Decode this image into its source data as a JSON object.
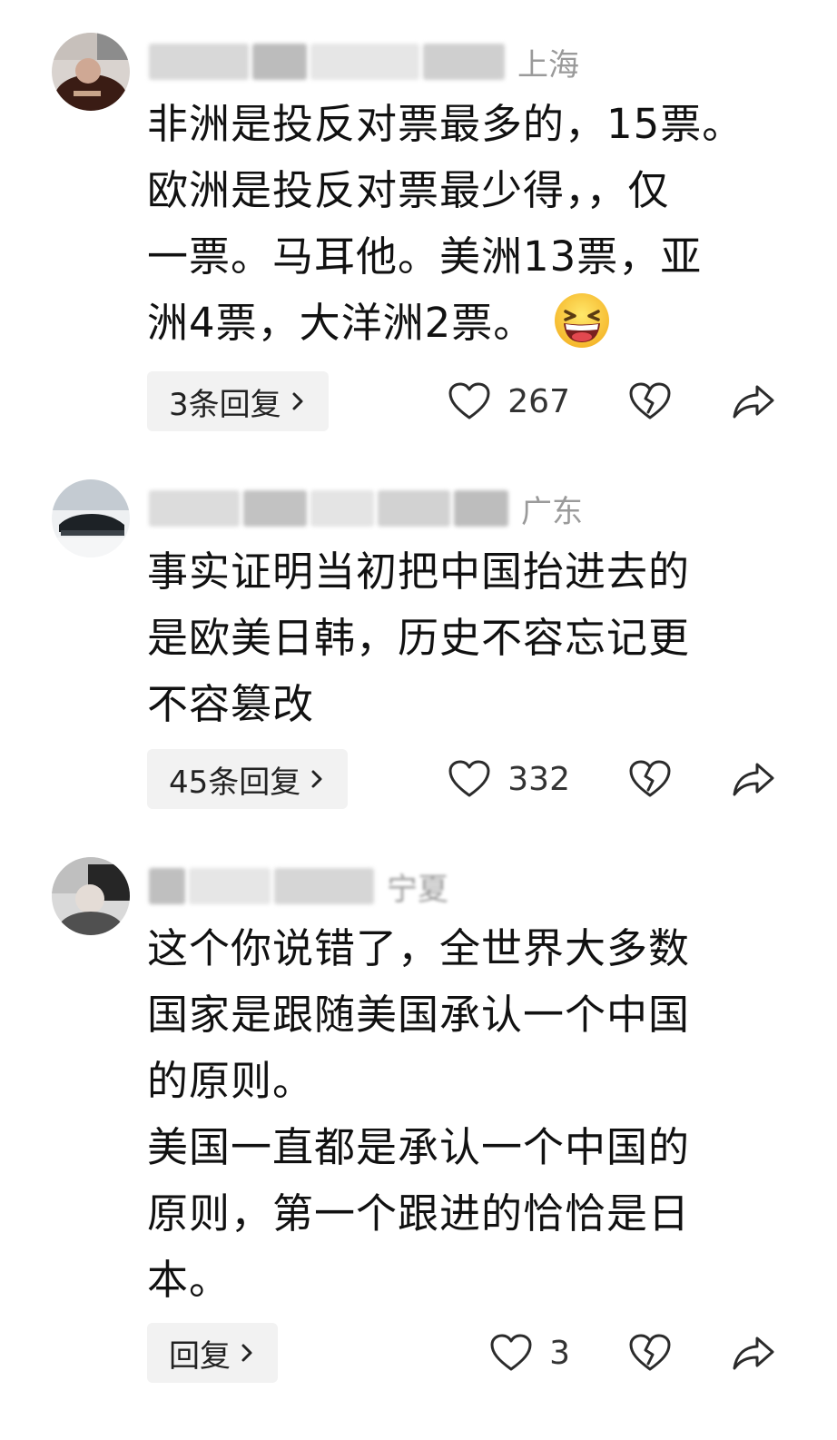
{
  "comments": [
    {
      "location": "上海",
      "lines": [
        "非洲是投反对票最多的，15票。",
        "欧洲是投反对票最少得，，仅",
        "一票。马耳他。美洲13票，亚",
        "洲4票，大洋洲2票。"
      ],
      "emoji": "grinning-squinting-face",
      "reply_label": "3条回复",
      "like_count": "267"
    },
    {
      "location": "广东",
      "lines": [
        "事实证明当初把中国抬进去的",
        "是欧美日韩，历史不容忘记更",
        "不容篡改"
      ],
      "reply_label": "45条回复",
      "like_count": "332"
    },
    {
      "location": "宁夏",
      "lines": [
        "这个你说错了，全世界大多数",
        "国家是跟随美国承认一个中国",
        "的原则。",
        "美国一直都是承认一个中国的",
        "原则，第一个跟进的恰恰是日",
        "本。"
      ],
      "reply_label": "回复",
      "like_count": "3"
    }
  ],
  "colors": {
    "meta_text": "#a3a3a3",
    "body_text": "#111111",
    "pill_bg": "#f2f2f2",
    "icon_stroke": "#2b2b2b"
  },
  "icons": [
    "heart-outline-icon",
    "broken-heart-icon",
    "share-arrow-icon",
    "chevron-right-icon"
  ]
}
